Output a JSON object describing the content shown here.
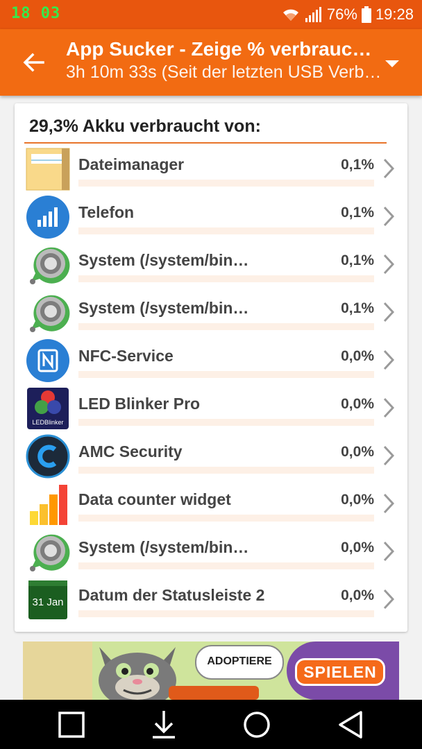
{
  "status_bar": {
    "counter": "18 03",
    "battery_percent": "76%",
    "time": "19:28",
    "icons": [
      "wifi-icon",
      "signal-icon",
      "battery-icon"
    ]
  },
  "app_bar": {
    "title": "App Sucker - Zeige % verbrauchter Akku",
    "subtitle": "3h 10m 33s (Seit der letzten USB Verbindung)",
    "icons": [
      "back-arrow-icon",
      "dropdown-arrow-icon"
    ]
  },
  "card": {
    "header": "29,3% Akku verbraucht von:",
    "rows": [
      {
        "name": "Dateimanager",
        "percent": "0,1%",
        "icon": "folder-icon"
      },
      {
        "name": "Telefon",
        "percent": "0,1%",
        "icon": "phone-signal-icon"
      },
      {
        "name": "System (/system/bin…",
        "percent": "0,1%",
        "icon": "system-icon"
      },
      {
        "name": "System (/system/bin…",
        "percent": "0,1%",
        "icon": "system-icon"
      },
      {
        "name": "NFC-Service",
        "percent": "0,0%",
        "icon": "nfc-icon"
      },
      {
        "name": "LED Blinker Pro",
        "percent": "0,0%",
        "icon": "led-blinker-icon"
      },
      {
        "name": "AMC Security",
        "percent": "0,0%",
        "icon": "amc-security-icon"
      },
      {
        "name": "Data counter widget",
        "percent": "0,0%",
        "icon": "data-counter-icon"
      },
      {
        "name": "System (/system/bin…",
        "percent": "0,0%",
        "icon": "system-icon"
      },
      {
        "name": "Datum der Statusleiste 2",
        "percent": "0,0%",
        "icon": "calendar-icon"
      }
    ],
    "led_icon_text": "LEDBlinker",
    "calendar_icon_text": "31 Jan"
  },
  "ad": {
    "bubble_text": "ADOPTIERE",
    "cta_label": "SPIELEN"
  },
  "nav_bar": {
    "buttons": [
      "recents-square-icon",
      "download-icon",
      "home-circle-icon",
      "back-triangle-icon"
    ]
  },
  "colors": {
    "status_bar": "#e8560e",
    "app_bar": "#f26b12",
    "accent_rule": "#e8742a",
    "progress_track": "#fdf0e6"
  }
}
